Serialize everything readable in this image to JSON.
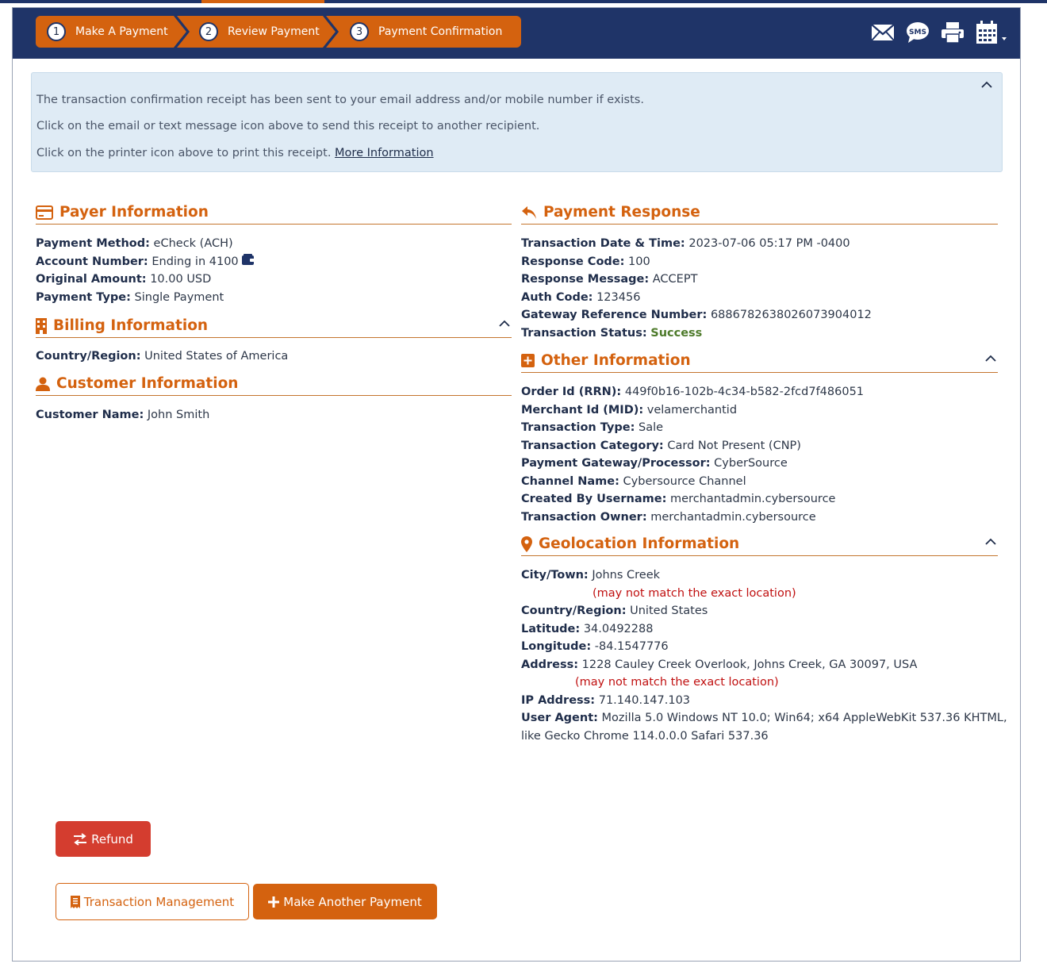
{
  "steps": [
    {
      "num": "1",
      "label": "Make A Payment"
    },
    {
      "num": "2",
      "label": "Review Payment"
    },
    {
      "num": "3",
      "label": "Payment Confirmation"
    }
  ],
  "header_icons": [
    "email-icon",
    "sms-icon",
    "printer-icon",
    "calendar-icon"
  ],
  "sms_text": "SMS",
  "notice": {
    "line1": "The transaction confirmation receipt has been sent to your email address and/or mobile number if exists.",
    "line2": "Click on the email or text message icon above to send this receipt to another recipient.",
    "line3": "Click on the printer icon above to print this receipt.",
    "link": "More Information"
  },
  "payer": {
    "title": "Payer Information",
    "rows": [
      {
        "k": "Payment Method:",
        "v": "eCheck (ACH)"
      },
      {
        "k": "Account Number:",
        "v": "Ending in 4100"
      },
      {
        "k": "Original Amount:",
        "v": "10.00 USD"
      },
      {
        "k": "Payment Type:",
        "v": "Single Payment"
      }
    ]
  },
  "billing": {
    "title": "Billing Information",
    "rows": [
      {
        "k": "Country/Region:",
        "v": "United States of America"
      }
    ]
  },
  "customer": {
    "title": "Customer Information",
    "rows": [
      {
        "k": "Customer Name:",
        "v": "John Smith"
      }
    ]
  },
  "response": {
    "title": "Payment Response",
    "rows": [
      {
        "k": "Transaction Date & Time:",
        "v": "2023-07-06 05:17 PM -0400"
      },
      {
        "k": "Response Code:",
        "v": "100"
      },
      {
        "k": "Response Message:",
        "v": "ACCEPT"
      },
      {
        "k": "Auth Code:",
        "v": "123456"
      },
      {
        "k": "Gateway Reference Number:",
        "v": "6886782638026073904012"
      },
      {
        "k": "Transaction Status:",
        "v": "Success"
      }
    ]
  },
  "other": {
    "title": "Other Information",
    "rows": [
      {
        "k": "Order Id (RRN):",
        "v": "449f0b16-102b-4c34-b582-2fcd7f486051"
      },
      {
        "k": "Merchant Id (MID):",
        "v": "velamerchantid"
      },
      {
        "k": "Transaction Type:",
        "v": "Sale"
      },
      {
        "k": "Transaction Category:",
        "v": "Card Not Present (CNP)"
      },
      {
        "k": "Payment Gateway/Processor:",
        "v": "CyberSource"
      },
      {
        "k": "Channel Name:",
        "v": "Cybersource Channel"
      },
      {
        "k": "Created By Username:",
        "v": "merchantadmin.cybersource"
      },
      {
        "k": "Transaction Owner:",
        "v": "merchantadmin.cybersource"
      }
    ]
  },
  "geo": {
    "title": "Geolocation Information",
    "city_k": "City/Town:",
    "city_v": "Johns Creek",
    "warning": "(may not match the exact location)",
    "country_k": "Country/Region:",
    "country_v": "United States",
    "lat_k": "Latitude:",
    "lat_v": "34.0492288",
    "lon_k": "Longitude:",
    "lon_v": "-84.1547776",
    "addr_k": "Address:",
    "addr_v": "1228 Cauley Creek Overlook, Johns Creek, GA 30097, USA",
    "ip_k": "IP Address:",
    "ip_v": "71.140.147.103",
    "ua_k": "User Agent:",
    "ua_v1": "Mozilla 5.0 Windows NT 10.0; Win64; x64 AppleWebKit 537.36 KHTML,",
    "ua_v2": "like Gecko Chrome 114.0.0.0 Safari 537.36"
  },
  "buttons": {
    "refund": "Refund",
    "transaction_management": "Transaction Management",
    "make_another": "Make Another Payment"
  },
  "colors": {
    "navy": "#1f3468",
    "orange": "#d4620f",
    "refund_red": "#d43d2f",
    "success_green": "#4d7a2a",
    "warning_red": "#c01010"
  }
}
